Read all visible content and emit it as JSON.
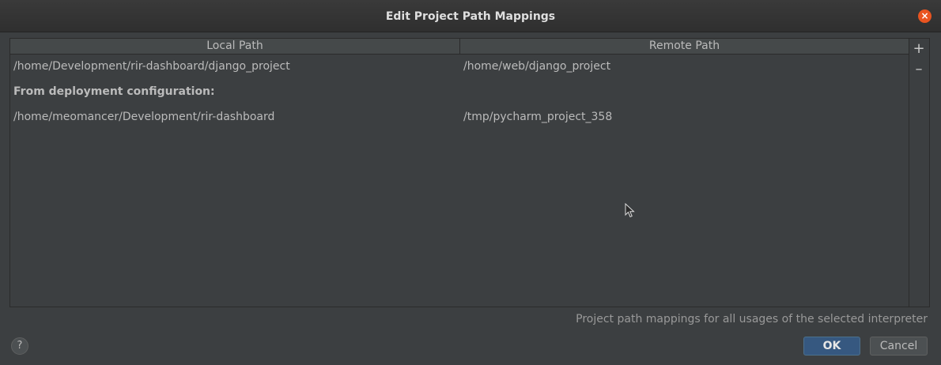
{
  "dialog": {
    "title": "Edit Project Path Mappings",
    "close_icon": "×"
  },
  "table": {
    "columns": [
      "Local Path",
      "Remote Path"
    ],
    "rows": [
      {
        "local": "/home/Development/rir-dashboard/django_project",
        "remote": "/home/web/django_project"
      }
    ],
    "group_label": "From deployment configuration:",
    "group_rows": [
      {
        "local": "/home/meomancer/Development/rir-dashboard",
        "remote": "/tmp/pycharm_project_358"
      }
    ]
  },
  "toolbar": {
    "add_icon": "+",
    "remove_icon": "–"
  },
  "hint": "Project path mappings for all usages of the selected interpreter",
  "footer": {
    "help_label": "?",
    "ok_label": "OK",
    "cancel_label": "Cancel"
  },
  "colors": {
    "background": "#3c3f41",
    "close_button": "#e95420",
    "ok_button": "#365880"
  }
}
